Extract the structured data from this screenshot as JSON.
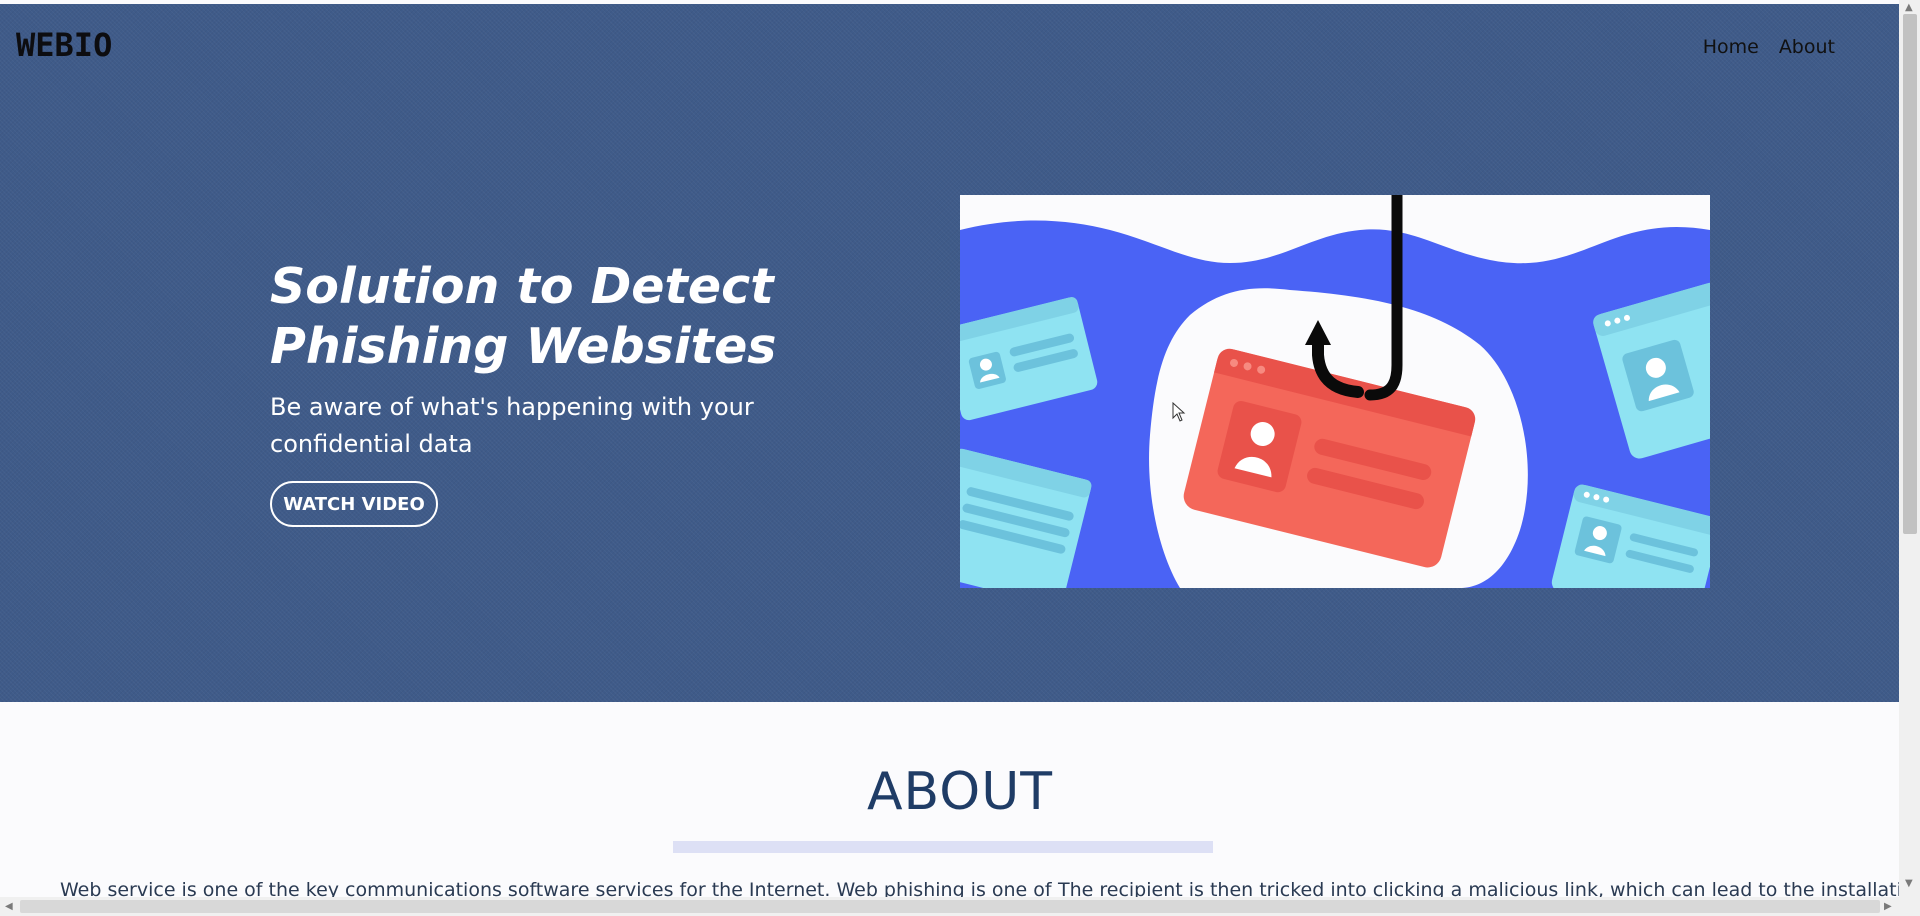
{
  "brand": {
    "logo": "WEBIO"
  },
  "nav": {
    "items": [
      "Home",
      "About"
    ]
  },
  "hero": {
    "title": "Solution to Detect Phishing Websites",
    "subtitle": "Be aware of what's happening with your confidential data",
    "cta_label": "WATCH VIDEO",
    "background_color": "#3f5b89",
    "illustration_icon": "phishing-hook-id-card-illustration"
  },
  "about": {
    "title": "ABOUT",
    "left_text": "Web service is one of the key communications software services for the Internet. Web phishing is one of",
    "right_text": "The recipient is then tricked into clicking a malicious link, which can lead to the installation"
  },
  "colors": {
    "hero_bg": "#3f5b89",
    "about_title": "#1f3c66",
    "wave_blue": "#4a63f5",
    "card_red": "#f4675a",
    "card_light": "#8fe3f2"
  },
  "scrollbars": {
    "vertical_up_icon": "arrow-up-icon",
    "vertical_down_icon": "arrow-down-icon",
    "horizontal_left_icon": "arrow-left-icon",
    "horizontal_right_icon": "arrow-right-icon"
  }
}
